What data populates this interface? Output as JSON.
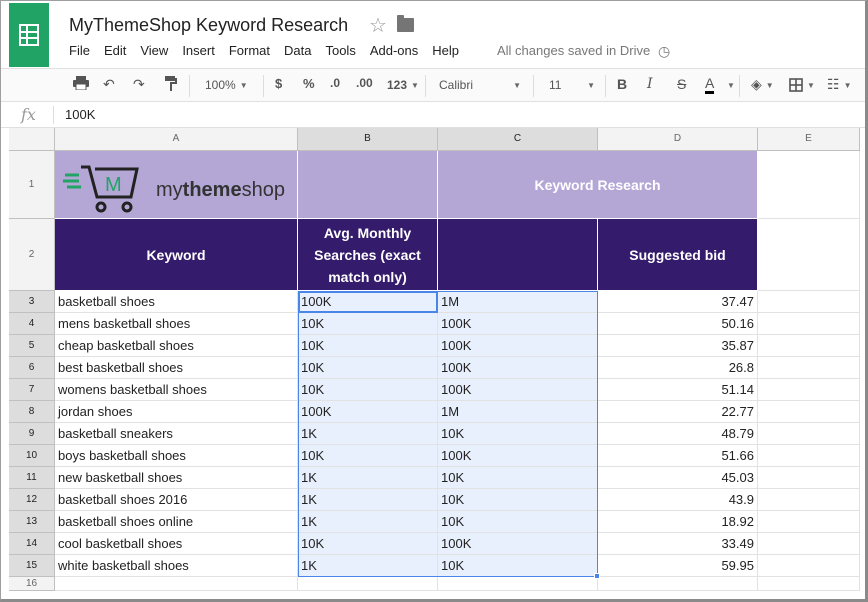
{
  "app": {
    "title": "MyThemeShop Keyword Research",
    "menu": [
      "File",
      "Edit",
      "View",
      "Insert",
      "Format",
      "Data",
      "Tools",
      "Add-ons",
      "Help"
    ],
    "save_status": "All changes saved in Drive"
  },
  "toolbar": {
    "zoom": "100%",
    "currency": "$",
    "percent": "%",
    "dec_decrease": ".0",
    "dec_increase": ".00",
    "more_formats": "123",
    "font": "Calibri",
    "font_size": "11",
    "bold": "B",
    "italic": "I",
    "strike": "S",
    "text_color": "A"
  },
  "formula_bar": {
    "fx": "fx",
    "value": "100K"
  },
  "columns": [
    "A",
    "B",
    "C",
    "D",
    "E"
  ],
  "rows": [
    "1",
    "2",
    "3",
    "4",
    "5",
    "6",
    "7",
    "8",
    "9",
    "10",
    "11",
    "12",
    "13",
    "14",
    "15",
    "16"
  ],
  "banner": {
    "brand_prefix": "my",
    "brand_bold": "theme",
    "brand_suffix": "shop",
    "title": "Keyword Research"
  },
  "headers": {
    "keyword": "Keyword",
    "searches": "Avg. Monthly Searches (exact match only)",
    "col_c": "",
    "bid": "Suggested bid"
  },
  "data": [
    {
      "keyword": "basketball shoes",
      "b": "100K",
      "c": "1M",
      "bid": "37.47"
    },
    {
      "keyword": "mens basketball shoes",
      "b": "10K",
      "c": "100K",
      "bid": "50.16"
    },
    {
      "keyword": "cheap basketball shoes",
      "b": "10K",
      "c": "100K",
      "bid": "35.87"
    },
    {
      "keyword": "best basketball shoes",
      "b": "10K",
      "c": "100K",
      "bid": "26.8"
    },
    {
      "keyword": "womens basketball shoes",
      "b": "10K",
      "c": "100K",
      "bid": "51.14"
    },
    {
      "keyword": "jordan shoes",
      "b": "100K",
      "c": "1M",
      "bid": "22.77"
    },
    {
      "keyword": "basketball sneakers",
      "b": "1K",
      "c": "10K",
      "bid": "48.79"
    },
    {
      "keyword": "boys basketball shoes",
      "b": "10K",
      "c": "100K",
      "bid": "51.66"
    },
    {
      "keyword": "new basketball shoes",
      "b": "1K",
      "c": "10K",
      "bid": "45.03"
    },
    {
      "keyword": "basketball shoes 2016",
      "b": "1K",
      "c": "10K",
      "bid": "43.9"
    },
    {
      "keyword": "basketball shoes online",
      "b": "1K",
      "c": "10K",
      "bid": "18.92"
    },
    {
      "keyword": "cool basketball shoes",
      "b": "10K",
      "c": "100K",
      "bid": "33.49"
    },
    {
      "keyword": "white basketball shoes",
      "b": "1K",
      "c": "10K",
      "bid": "59.95"
    }
  ]
}
